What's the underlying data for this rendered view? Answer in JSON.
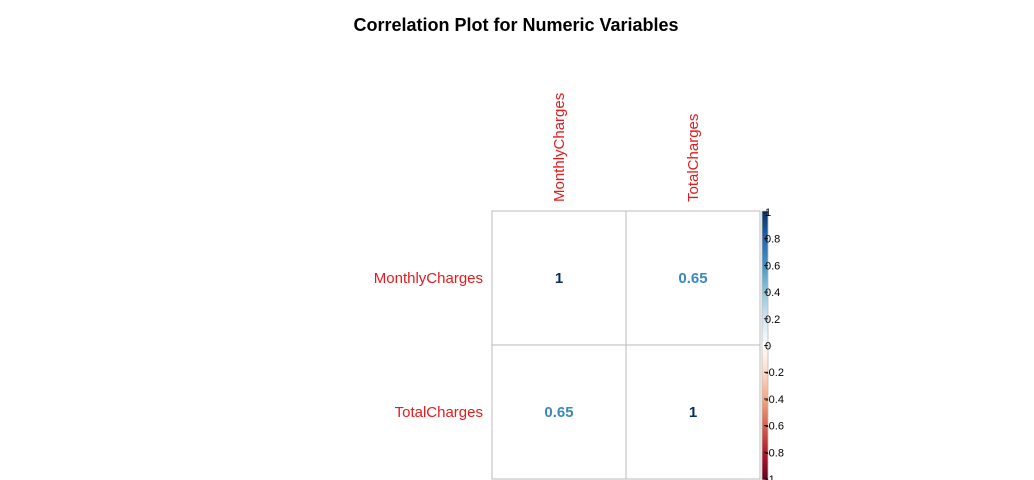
{
  "chart_data": {
    "type": "heatmap",
    "title": "Correlation Plot for Numeric Variables",
    "variables": [
      "MonthlyCharges",
      "TotalCharges"
    ],
    "matrix": [
      [
        1,
        0.65
      ],
      [
        0.65,
        1
      ]
    ],
    "value_labels": [
      [
        "1",
        "0.65"
      ],
      [
        "0.65",
        "1"
      ]
    ],
    "color_scale": {
      "range": [
        -1,
        1
      ],
      "ticks": [
        "1",
        "0.8",
        "0.6",
        "0.4",
        "0.2",
        "0",
        "-0.2",
        "-0.4",
        "-0.6",
        "-0.8",
        "-1"
      ],
      "colors": {
        "negative": "#67001F",
        "mid": "#FFFFFF",
        "positive": "#053061"
      }
    },
    "label_color": "#E41A1C",
    "grid_color": "#BBBBBB"
  }
}
